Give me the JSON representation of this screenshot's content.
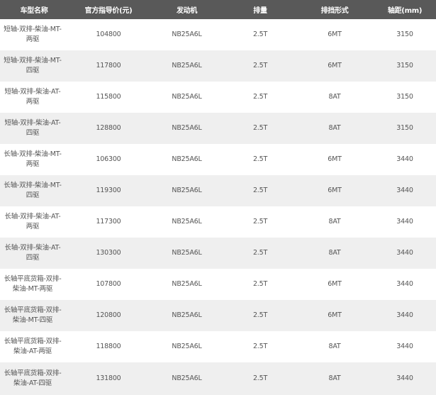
{
  "table": {
    "headers": [
      "车型名称",
      "官方指导价(元)",
      "发动机",
      "排量",
      "排挡形式",
      "轴距(mm)"
    ],
    "rows": [
      {
        "name": "短轴-双排-柴油-MT-两驱",
        "price": "104800",
        "engine": "NB25A6L",
        "displacement": "2.5T",
        "transmission": "6MT",
        "wheelbase": "3150"
      },
      {
        "name": "短轴-双排-柴油-MT-四驱",
        "price": "117800",
        "engine": "NB25A6L",
        "displacement": "2.5T",
        "transmission": "6MT",
        "wheelbase": "3150"
      },
      {
        "name": "短轴-双排-柴油-AT-两驱",
        "price": "115800",
        "engine": "NB25A6L",
        "displacement": "2.5T",
        "transmission": "8AT",
        "wheelbase": "3150"
      },
      {
        "name": "短轴-双排-柴油-AT-四驱",
        "price": "128800",
        "engine": "NB25A6L",
        "displacement": "2.5T",
        "transmission": "8AT",
        "wheelbase": "3150"
      },
      {
        "name": "长轴-双排-柴油-MT-两驱",
        "price": "106300",
        "engine": "NB25A6L",
        "displacement": "2.5T",
        "transmission": "6MT",
        "wheelbase": "3440"
      },
      {
        "name": "长轴-双排-柴油-MT-四驱",
        "price": "119300",
        "engine": "NB25A6L",
        "displacement": "2.5T",
        "transmission": "6MT",
        "wheelbase": "3440"
      },
      {
        "name": "长轴-双排-柴油-AT-两驱",
        "price": "117300",
        "engine": "NB25A6L",
        "displacement": "2.5T",
        "transmission": "8AT",
        "wheelbase": "3440"
      },
      {
        "name": "长轴-双排-柴油-AT-四驱",
        "price": "130300",
        "engine": "NB25A6L",
        "displacement": "2.5T",
        "transmission": "8AT",
        "wheelbase": "3440"
      },
      {
        "name": "长轴平底货箱-双排-柴油-MT-两驱",
        "price": "107800",
        "engine": "NB25A6L",
        "displacement": "2.5T",
        "transmission": "6MT",
        "wheelbase": "3440"
      },
      {
        "name": "长轴平底货箱-双排-柴油-MT-四驱",
        "price": "120800",
        "engine": "NB25A6L",
        "displacement": "2.5T",
        "transmission": "6MT",
        "wheelbase": "3440"
      },
      {
        "name": "长轴平底货箱-双排-柴油-AT-两驱",
        "price": "118800",
        "engine": "NB25A6L",
        "displacement": "2.5T",
        "transmission": "8AT",
        "wheelbase": "3440"
      },
      {
        "name": "长轴平底货箱-双排-柴油-AT-四驱",
        "price": "131800",
        "engine": "NB25A6L",
        "displacement": "2.5T",
        "transmission": "8AT",
        "wheelbase": "3440"
      }
    ]
  },
  "colors": {
    "header_bg": "#595959",
    "header_text": "#ffffff",
    "row_alt_bg": "#efefef",
    "cell_text": "#555555"
  }
}
